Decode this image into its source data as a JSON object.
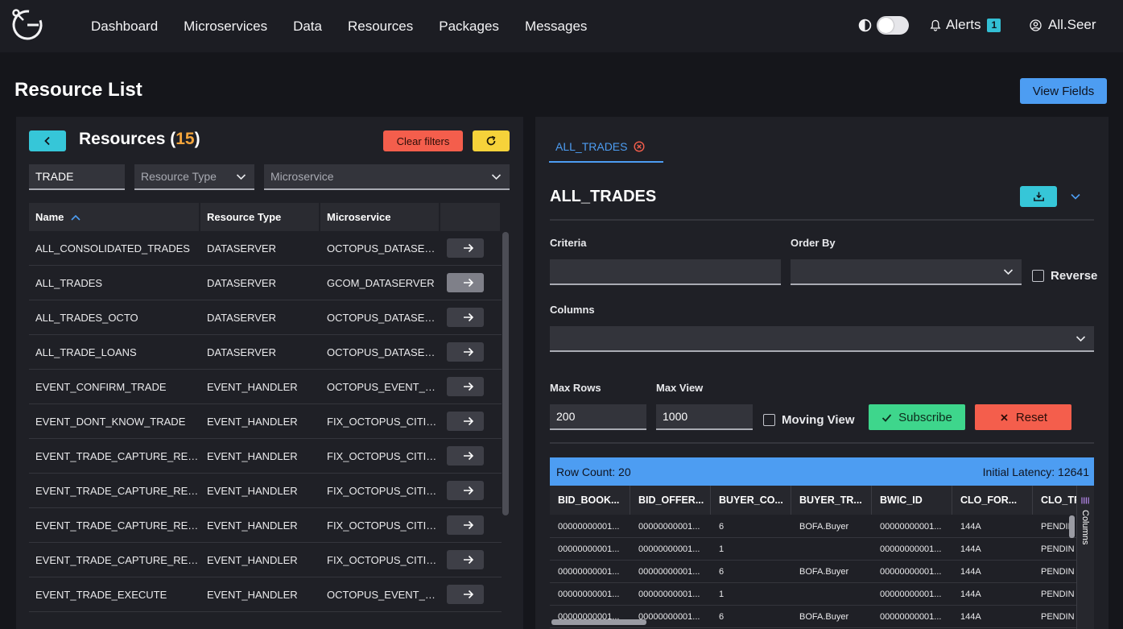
{
  "nav": {
    "items": [
      "Dashboard",
      "Microservices",
      "Data",
      "Resources",
      "Packages",
      "Messages"
    ],
    "alerts_label": "Alerts",
    "alerts_count": "1",
    "user_label": "All.Seer"
  },
  "page": {
    "title": "Resource List",
    "view_fields_label": "View Fields"
  },
  "resources": {
    "title": "Resources",
    "count": "15",
    "clear_filters_label": "Clear filters",
    "filter_name_value": "TRADE",
    "filter_type_placeholder": "Resource Type",
    "filter_microservice_placeholder": "Microservice",
    "columns": [
      "Name",
      "Resource Type",
      "Microservice"
    ],
    "rows": [
      {
        "name": "ALL_CONSOLIDATED_TRADES",
        "type": "DATASERVER",
        "ms": "OCTOPUS_DATASER..."
      },
      {
        "name": "ALL_TRADES",
        "type": "DATASERVER",
        "ms": "GCOM_DATASERVER"
      },
      {
        "name": "ALL_TRADES_OCTO",
        "type": "DATASERVER",
        "ms": "OCTOPUS_DATASER..."
      },
      {
        "name": "ALL_TRADE_LOANS",
        "type": "DATASERVER",
        "ms": "OCTOPUS_DATASER..."
      },
      {
        "name": "EVENT_CONFIRM_TRADE",
        "type": "EVENT_HANDLER",
        "ms": "OCTOPUS_EVENT_H..."
      },
      {
        "name": "EVENT_DONT_KNOW_TRADE",
        "type": "EVENT_HANDLER",
        "ms": "FIX_OCTOPUS_CITI_..."
      },
      {
        "name": "EVENT_TRADE_CAPTURE_REPO...",
        "type": "EVENT_HANDLER",
        "ms": "FIX_OCTOPUS_CITI_..."
      },
      {
        "name": "EVENT_TRADE_CAPTURE_REPO...",
        "type": "EVENT_HANDLER",
        "ms": "FIX_OCTOPUS_CITI_..."
      },
      {
        "name": "EVENT_TRADE_CAPTURE_REPO...",
        "type": "EVENT_HANDLER",
        "ms": "FIX_OCTOPUS_CITI_..."
      },
      {
        "name": "EVENT_TRADE_CAPTURE_REPO...",
        "type": "EVENT_HANDLER",
        "ms": "FIX_OCTOPUS_CITI_..."
      },
      {
        "name": "EVENT_TRADE_EXECUTE",
        "type": "EVENT_HANDLER",
        "ms": "OCTOPUS_EVENT_H..."
      }
    ]
  },
  "detail": {
    "tab_label": "ALL_TRADES",
    "title": "ALL_TRADES",
    "criteria_label": "Criteria",
    "order_by_label": "Order By",
    "reverse_label": "Reverse",
    "columns_label": "Columns",
    "max_rows_label": "Max Rows",
    "max_rows_value": "200",
    "max_view_label": "Max View",
    "max_view_value": "1000",
    "moving_view_label": "Moving View",
    "subscribe_label": "Subscribe",
    "reset_label": "Reset",
    "row_count_text": "Row Count: 20",
    "latency_text": "Initial Latency: 12641",
    "columns_side_label": "Columns",
    "grid_columns": [
      "BID_BOOK...",
      "BID_OFFER...",
      "BUYER_CO...",
      "BUYER_TR...",
      "BWIC_ID",
      "CLO_FOR...",
      "CLO_TR"
    ],
    "grid_rows": [
      [
        "00000000001...",
        "00000000001...",
        "6",
        "BOFA.Buyer",
        "00000000001...",
        "144A",
        "PENDIN"
      ],
      [
        "00000000001...",
        "00000000001...",
        "1",
        "",
        "00000000001...",
        "144A",
        "PENDIN"
      ],
      [
        "00000000001...",
        "00000000001...",
        "6",
        "BOFA.Buyer",
        "00000000001...",
        "144A",
        "PENDIN"
      ],
      [
        "00000000001...",
        "00000000001...",
        "1",
        "",
        "00000000001...",
        "144A",
        "PENDIN"
      ],
      [
        "00000000001...",
        "00000000001...",
        "6",
        "BOFA.Buyer",
        "00000000001...",
        "144A",
        "PENDIN"
      ]
    ]
  }
}
